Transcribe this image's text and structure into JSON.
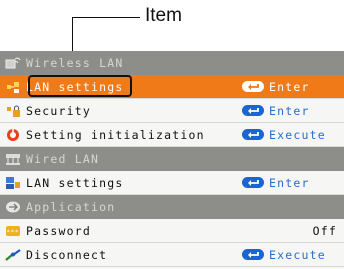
{
  "callout": {
    "label": "Item"
  },
  "menu": {
    "rows": [
      {
        "kind": "section",
        "icon": "wireless-network-icon",
        "label": "Wireless LAN"
      },
      {
        "kind": "item",
        "icon": "network-settings-icon",
        "label": "LAN settings",
        "action": "Enter",
        "selected": true
      },
      {
        "kind": "item",
        "icon": "security-lock-icon",
        "label": "Security",
        "action": "Enter"
      },
      {
        "kind": "item",
        "icon": "reset-icon",
        "label": "Setting initialization",
        "action": "Execute"
      },
      {
        "kind": "section",
        "icon": "wired-network-icon",
        "label": "Wired LAN"
      },
      {
        "kind": "item",
        "icon": "network-settings-icon",
        "label": "LAN settings",
        "action": "Enter"
      },
      {
        "kind": "section",
        "icon": "application-icon",
        "label": "Application"
      },
      {
        "kind": "item",
        "icon": "password-icon",
        "label": "Password",
        "value": "Off"
      },
      {
        "kind": "item",
        "icon": "disconnect-icon",
        "label": "Disconnect",
        "action": "Execute"
      }
    ]
  },
  "colors": {
    "selected": "#f07a18",
    "section": "#8d8d8a",
    "action_blue": "#1f6fd0"
  }
}
